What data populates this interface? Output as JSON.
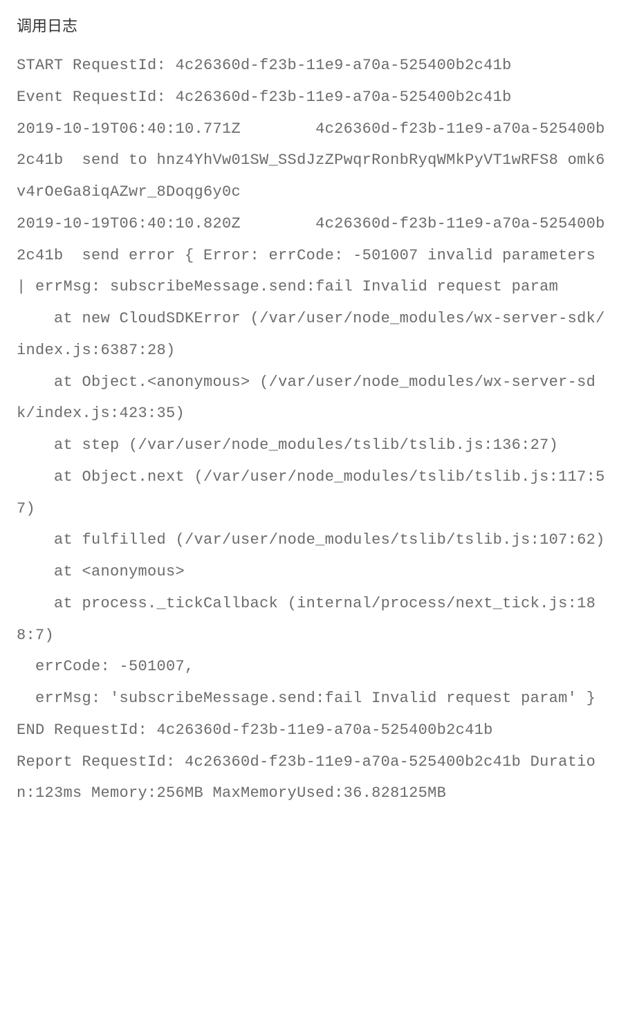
{
  "title": "调用日志",
  "log_lines": [
    "START RequestId: 4c26360d-f23b-11e9-a70a-525400b2c41b",
    "Event RequestId: 4c26360d-f23b-11e9-a70a-525400b2c41b",
    "2019-10-19T06:40:10.771Z        4c26360d-f23b-11e9-a70a-525400b2c41b  send to hnz4YhVw01SW_SSdJzZPwqrRonbRyqWMkPyVT1wRFS8 omk6v4rOeGa8iqAZwr_8Doqg6y0c",
    "2019-10-19T06:40:10.820Z        4c26360d-f23b-11e9-a70a-525400b2c41b  send error { Error: errCode: -501007 invalid parameters | errMsg: subscribeMessage.send:fail Invalid request param",
    "    at new CloudSDKError (/var/user/node_modules/wx-server-sdk/index.js:6387:28)",
    "    at Object.<anonymous> (/var/user/node_modules/wx-server-sdk/index.js:423:35)",
    "    at step (/var/user/node_modules/tslib/tslib.js:136:27)",
    "    at Object.next (/var/user/node_modules/tslib/tslib.js:117:57)",
    "    at fulfilled (/var/user/node_modules/tslib/tslib.js:107:62)",
    "    at <anonymous>",
    "    at process._tickCallback (internal/process/next_tick.js:188:7)",
    "  errCode: -501007,",
    "  errMsg: 'subscribeMessage.send:fail Invalid request param' }",
    "END RequestId: 4c26360d-f23b-11e9-a70a-525400b2c41b",
    "Report RequestId: 4c26360d-f23b-11e9-a70a-525400b2c41b Duration:123ms Memory:256MB MaxMemoryUsed:36.828125MB"
  ]
}
